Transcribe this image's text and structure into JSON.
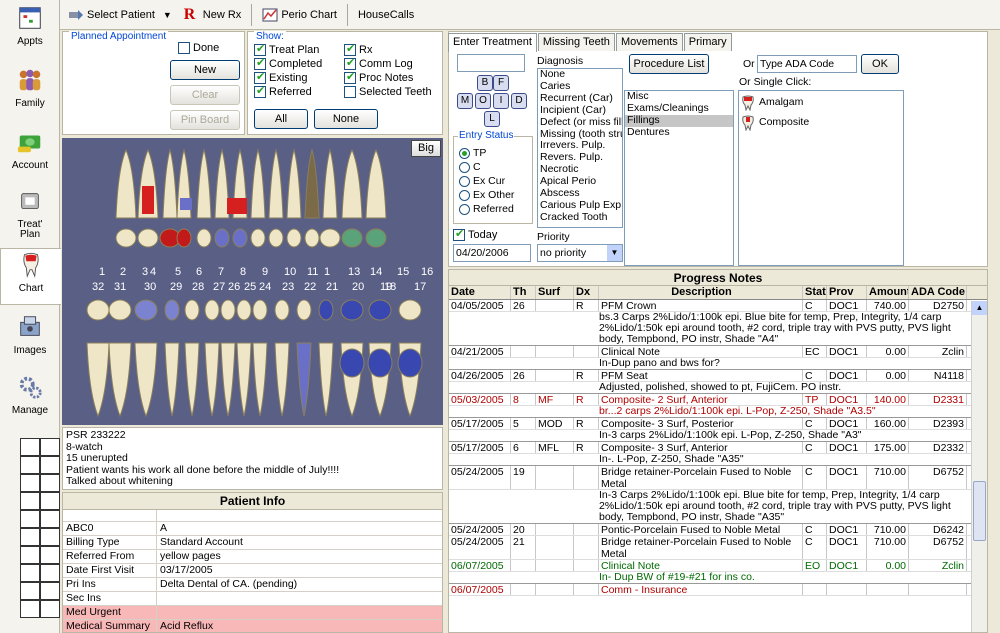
{
  "toolbar": {
    "select_patient": "Select Patient",
    "new_rx": "New Rx",
    "perio_chart": "Perio Chart",
    "housecalls": "HouseCalls"
  },
  "nav": {
    "appts": "Appts",
    "family": "Family",
    "account": "Account",
    "treat_plan_1": "Treat'",
    "treat_plan_2": "Plan",
    "chart": "Chart",
    "images": "Images",
    "manage": "Manage"
  },
  "planned": {
    "title": "Planned Appointment",
    "done_label": "Done",
    "new_btn": "New",
    "clear_btn": "Clear",
    "pin_btn": "Pin Board"
  },
  "show": {
    "title": "Show:",
    "items": [
      {
        "label": "Treat Plan",
        "checked": true
      },
      {
        "label": "Completed",
        "checked": true
      },
      {
        "label": "Existing",
        "checked": true
      },
      {
        "label": "Referred",
        "checked": true
      },
      {
        "label": "Rx",
        "checked": true
      },
      {
        "label": "Comm Log",
        "checked": true
      },
      {
        "label": "Proc Notes",
        "checked": true
      },
      {
        "label": "Selected Teeth",
        "checked": false
      }
    ],
    "all_btn": "All",
    "none_btn": "None"
  },
  "chart": {
    "big_btn": "Big",
    "upper_numbers": [
      "1",
      "2",
      "3",
      "4",
      "5",
      "6",
      "7",
      "8",
      "9",
      "10",
      "11",
      "1",
      "13",
      "14",
      "15",
      "16"
    ],
    "lower_numbers": [
      "32",
      "31",
      "30",
      "29",
      "28",
      "27",
      "26",
      "25",
      "24",
      "23",
      "22",
      "21",
      "20",
      "19",
      "18",
      "17"
    ]
  },
  "notes_box": {
    "lines": [
      "PSR  233222",
      "8-watch",
      "15 unerupted",
      "Patient wants his work all done before the middle of July!!!!",
      "Talked about whitening"
    ]
  },
  "patient_info": {
    "title": "Patient Info",
    "rows": [
      {
        "k": "ABC0",
        "v": "A"
      },
      {
        "k": "Billing Type",
        "v": "Standard Account"
      },
      {
        "k": "Referred From",
        "v": "yellow pages"
      },
      {
        "k": "Date First Visit",
        "v": "03/17/2005"
      },
      {
        "k": "Pri Ins",
        "v": "Delta Dental of CA. (pending)"
      },
      {
        "k": "Sec Ins",
        "v": ""
      },
      {
        "k": "Med Urgent",
        "v": ""
      },
      {
        "k": "Medical Summary",
        "v": "Acid Reflux"
      }
    ]
  },
  "treatment": {
    "tabs": [
      "Enter Treatment",
      "Missing Teeth",
      "Movements",
      "Primary"
    ],
    "surface_buttons": [
      "B",
      "F",
      "M",
      "O",
      "I",
      "D",
      "L"
    ],
    "entry_status_title": "Entry Status",
    "entry_status": [
      "TP",
      "C",
      "Ex Cur",
      "Ex Other",
      "Referred"
    ],
    "today_label": "Today",
    "date_value": "04/20/2006",
    "diagnosis_title": "Diagnosis",
    "diagnosis": [
      "None",
      "Caries",
      "Recurrent (Car)",
      "Incipient (Car)",
      "Defect (or miss fill)",
      "Missing (tooth struc",
      "Irrevers. Pulp.",
      "Revers. Pulp.",
      "Necrotic",
      "Apical Perio",
      "Abscess",
      "Carious Pulp Exp",
      "Cracked Tooth"
    ],
    "priority_title": "Priority",
    "priority_value": "no priority",
    "procedure_list_btn": "Procedure List",
    "or_label": "Or",
    "ada_placeholder": "Type ADA Code",
    "ok_btn": "OK",
    "single_click_label": "Or Single Click:",
    "categories": [
      "Misc",
      "Exams/Cleanings",
      "Fillings",
      "Dentures"
    ],
    "selected_category": "Fillings",
    "quick_procs": [
      "Amalgam",
      "Composite"
    ]
  },
  "progress": {
    "title": "Progress Notes",
    "headers": [
      "Date",
      "Th",
      "Surf",
      "Dx",
      "Description",
      "Stat",
      "Prov",
      "Amount",
      "ADA Code"
    ],
    "rows": [
      {
        "date": "04/05/2005",
        "th": "26",
        "surf": "",
        "dx": "R",
        "desc": "PFM Crown",
        "stat": "C",
        "prov": "DOC1",
        "amt": "740.00",
        "ada": "D2750",
        "color": "",
        "note": "bs.3 Carps 2%Lido/1:100k epi.  Blue bite for temp, Prep, Integrity, 1/4 carp 2%Lido/1:50k epi around tooth, #2 cord,  triple tray with PVS putty, PVS light body, Tempbond, PO instr, Shade \"A4\"",
        "note_lines": 3
      },
      {
        "date": "04/21/2005",
        "th": "",
        "surf": "",
        "dx": "",
        "desc": "Clinical Note",
        "stat": "EC",
        "prov": "DOC1",
        "amt": "0.00",
        "ada": "Zclin",
        "color": "",
        "note": "In-Dup pano and bws for?",
        "note_lines": 1
      },
      {
        "date": "04/26/2005",
        "th": "26",
        "surf": "",
        "dx": "R",
        "desc": "PFM Seat",
        "stat": "C",
        "prov": "DOC1",
        "amt": "0.00",
        "ada": "N4118",
        "color": "",
        "note": "Adjusted, polished, showed to pt, FujiCem.  PO instr.",
        "note_lines": 1
      },
      {
        "date": "05/03/2005",
        "th": "8",
        "surf": "MF",
        "dx": "R",
        "desc": "Composite- 2 Surf, Anterior",
        "stat": "TP",
        "prov": "DOC1",
        "amt": "140.00",
        "ada": "D2331",
        "color": "red",
        "note": "br...2 carps 2%Lido/1:100k epi. L-Pop, Z-250, Shade \"A3.5\"",
        "note_lines": 1
      },
      {
        "date": "05/17/2005",
        "th": "5",
        "surf": "MOD",
        "dx": "R",
        "desc": "Composite- 3 Surf, Posterior",
        "stat": "C",
        "prov": "DOC1",
        "amt": "160.00",
        "ada": "D2393",
        "color": "",
        "note": "In-3 carps 2%Lido/1:100k epi. L-Pop, Z-250, Shade \"A3\"",
        "note_lines": 1
      },
      {
        "date": "05/17/2005",
        "th": "6",
        "surf": "MFL",
        "dx": "R",
        "desc": "Composite- 3 Surf, Anterior",
        "stat": "C",
        "prov": "DOC1",
        "amt": "175.00",
        "ada": "D2332",
        "color": "",
        "note": "In-. L-Pop, Z-250, Shade \"A35\"",
        "note_lines": 1
      },
      {
        "date": "05/24/2005",
        "th": "19",
        "surf": "",
        "dx": "",
        "desc": "Bridge retainer-Porcelain Fused to Noble Metal",
        "stat": "C",
        "prov": "DOC1",
        "amt": "710.00",
        "ada": "D6752",
        "color": "",
        "note": "In-3 Carps 2%Lido/1:100k epi.  Blue bite for temp, Prep, Integrity, 1/4 carp 2%Lido/1:50k epi around tooth, #2 cord,  triple tray with PVS putty, PVS light body, Tempbond, PO instr, Shade \"A35\"",
        "note_lines": 3
      },
      {
        "date": "05/24/2005",
        "th": "20",
        "surf": "",
        "dx": "",
        "desc": "Pontic-Porcelain Fused to Noble Metal",
        "stat": "C",
        "prov": "DOC1",
        "amt": "710.00",
        "ada": "D6242",
        "color": "",
        "note": "",
        "note_lines": 0
      },
      {
        "date": "05/24/2005",
        "th": "21",
        "surf": "",
        "dx": "",
        "desc": "Bridge retainer-Porcelain Fused to Noble Metal",
        "stat": "C",
        "prov": "DOC1",
        "amt": "710.00",
        "ada": "D6752",
        "color": "",
        "note": "",
        "note_lines": 0
      },
      {
        "date": "06/07/2005",
        "th": "",
        "surf": "",
        "dx": "",
        "desc": "Clinical Note",
        "stat": "EO",
        "prov": "DOC1",
        "amt": "0.00",
        "ada": "Zclin",
        "color": "green",
        "note": "In- Dup BW of #19-#21 for ins co.",
        "note_lines": 1
      },
      {
        "date": "06/07/2005",
        "th": "",
        "surf": "",
        "dx": "",
        "desc": "Comm - Insurance",
        "stat": "",
        "prov": "",
        "amt": "",
        "ada": "",
        "color": "red",
        "note": "",
        "note_lines": 0
      }
    ]
  }
}
